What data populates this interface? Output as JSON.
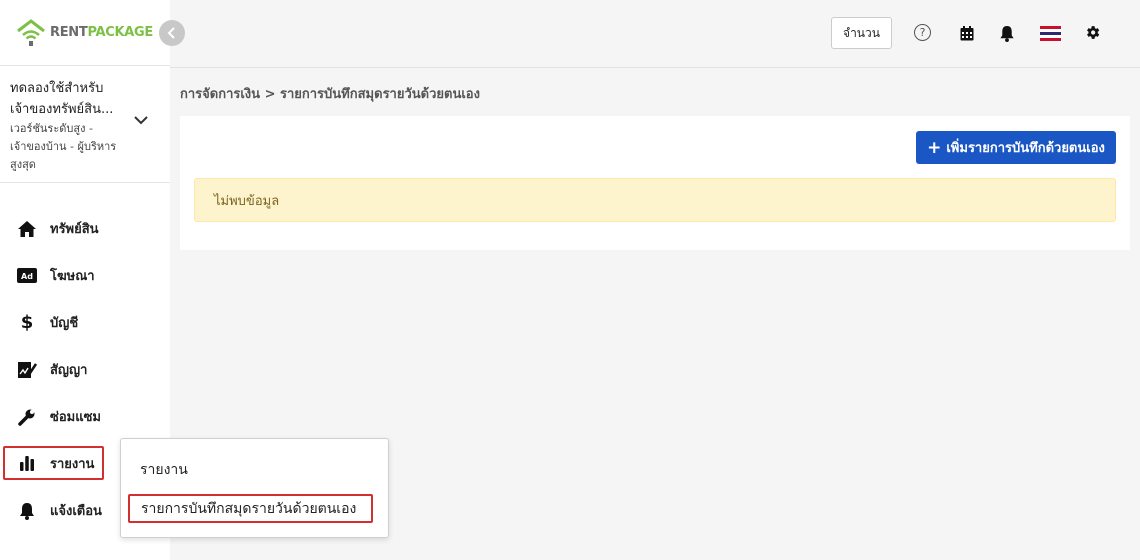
{
  "brand": {
    "rent": "RENT",
    "package": "PACKAGE"
  },
  "account": {
    "title": "ทดลองใช้สำหรับเจ้าของทรัพย์สิน...",
    "subtitle": "เวอร์ชันระดับสูง - เจ้าของบ้าน - ผู้บริหารสูงสุด"
  },
  "nav": [
    {
      "label": "ทรัพย์สิน",
      "icon": "home-icon"
    },
    {
      "label": "โฆษณา",
      "icon": "ad-icon"
    },
    {
      "label": "บัญชี",
      "icon": "dollar-icon"
    },
    {
      "label": "สัญญา",
      "icon": "contract-icon"
    },
    {
      "label": "ซ่อมแซม",
      "icon": "wrench-icon"
    },
    {
      "label": "รายงาน",
      "icon": "bar-chart-icon"
    },
    {
      "label": "แจ้งเตือน",
      "icon": "bell-icon"
    }
  ],
  "topbar": {
    "count_label": "จำนวน",
    "help": "?"
  },
  "breadcrumb": "การจัดการเงิน > รายการบันทึกสมุดรายวันด้วยตนเอง",
  "main": {
    "add_button": "เพิ่มรายการบันทึกด้วยตนเอง",
    "add_plus": "+",
    "empty_message": "ไม่พบข้อมูล"
  },
  "submenu": {
    "items": [
      "รายงาน",
      "รายการบันทึกสมุดรายวันด้วยตนเอง"
    ]
  },
  "colors": {
    "brand_green": "#7cc044",
    "primary_button": "#1b57c4",
    "highlight_red": "#d32f2f",
    "alert_bg": "#fdf3cd"
  }
}
